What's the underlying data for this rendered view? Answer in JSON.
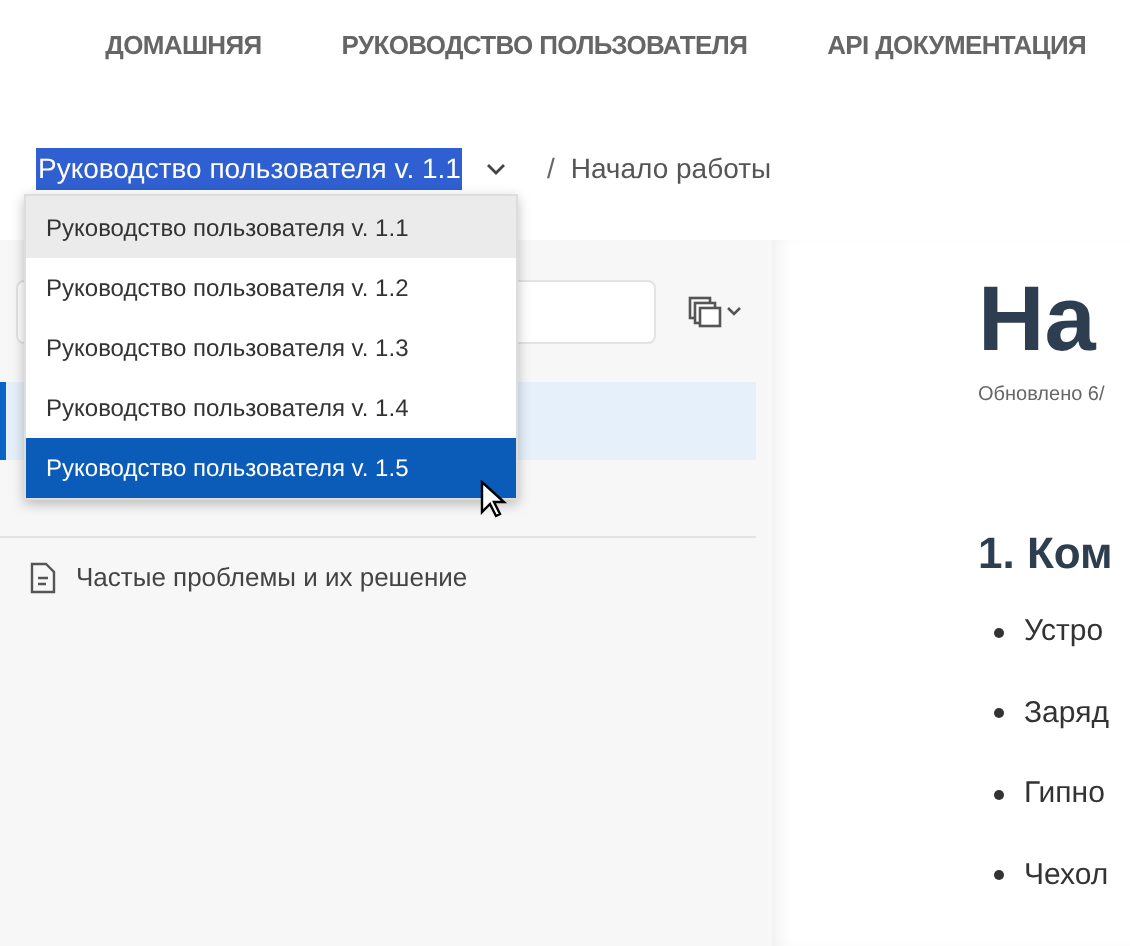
{
  "nav": [
    {
      "label": "ДОМАШНЯЯ"
    },
    {
      "label": "РУКОВОДСТВО ПОЛЬЗОВАТЕЛЯ"
    },
    {
      "label": "API ДОКУМЕНТАЦИЯ"
    }
  ],
  "breadcrumb": {
    "version": "Руководство пользователя v. 1.1",
    "separator": "/",
    "page": "Начало работы"
  },
  "version_menu": [
    {
      "label": "Руководство пользователя v. 1.1",
      "selected": true,
      "hovered": false
    },
    {
      "label": "Руководство пользователя v. 1.2",
      "selected": false,
      "hovered": false
    },
    {
      "label": "Руководство пользователя v. 1.3",
      "selected": false,
      "hovered": false
    },
    {
      "label": "Руководство пользователя v. 1.4",
      "selected": false,
      "hovered": false
    },
    {
      "label": "Руководство пользователя v. 1.5",
      "selected": false,
      "hovered": true
    }
  ],
  "sidebar": {
    "items": [
      {
        "label": "Частые проблемы и их решение"
      }
    ]
  },
  "content": {
    "title": "На",
    "updated": "Обновлено 6/",
    "heading": "1. Ком",
    "bullets": [
      "Устро",
      "Заряд",
      "Гипно",
      "Чехол"
    ]
  }
}
